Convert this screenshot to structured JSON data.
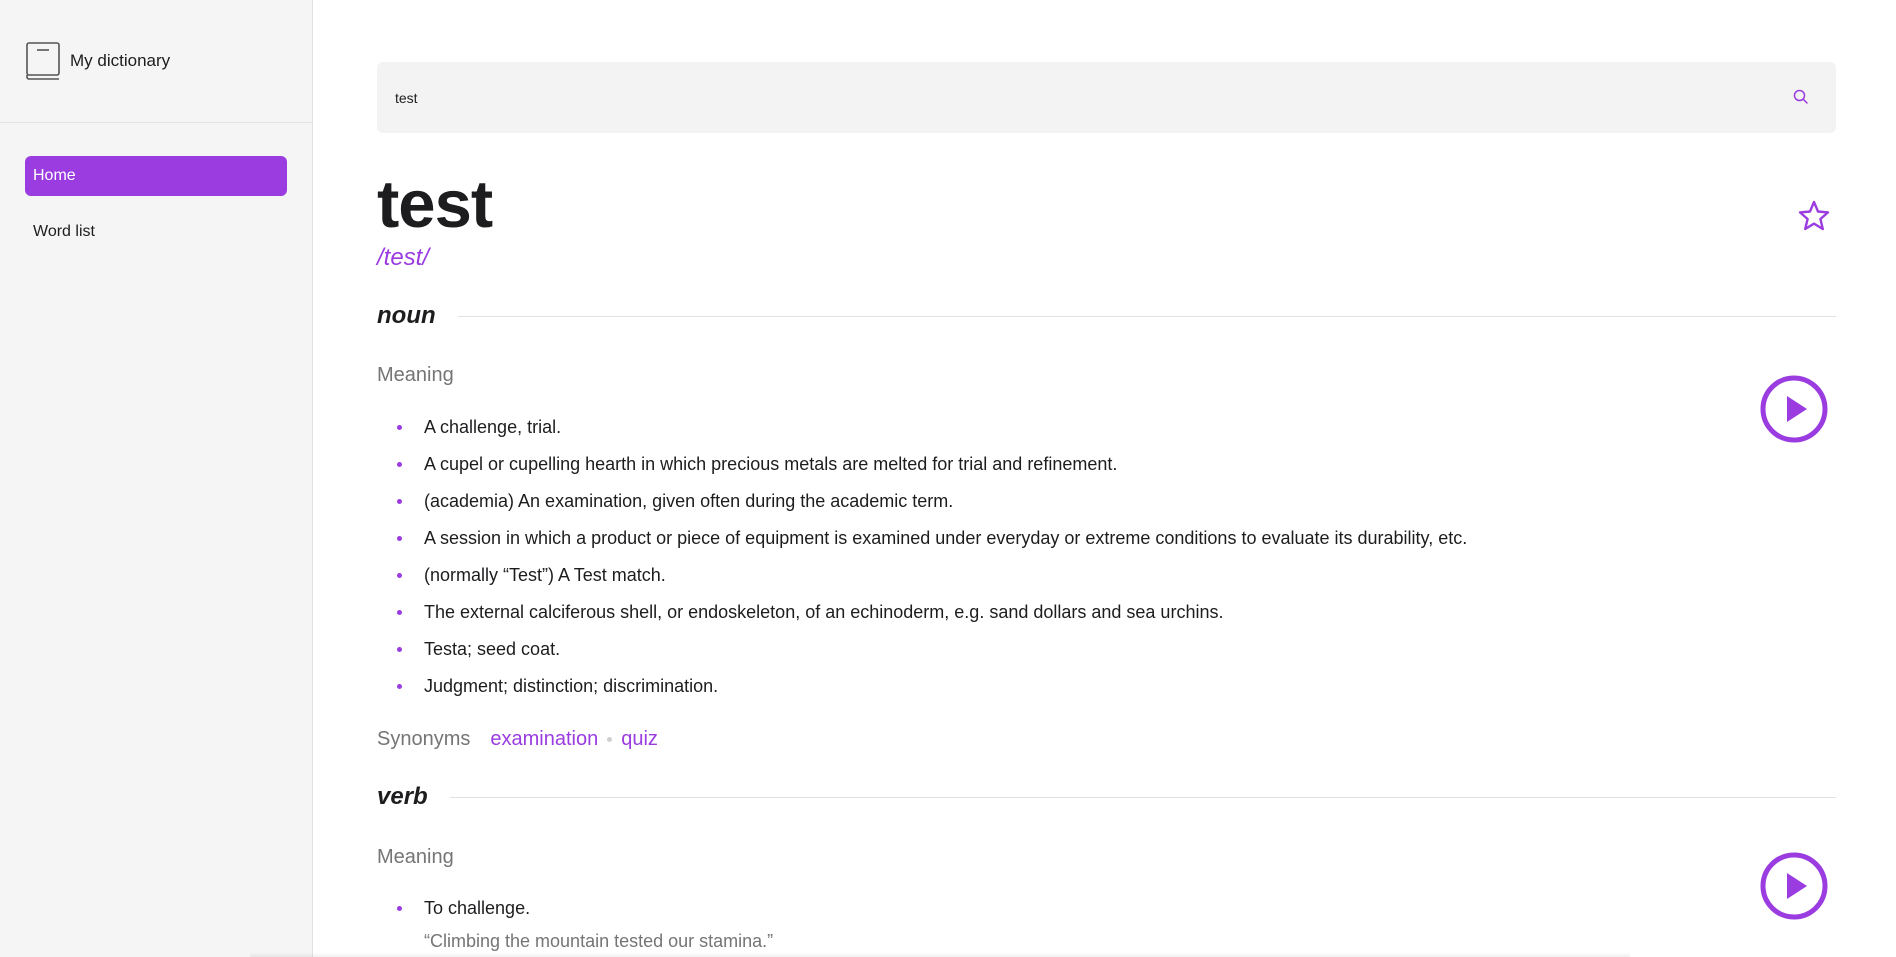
{
  "sidebar": {
    "brand": "My dictionary",
    "items": [
      {
        "label": "Home",
        "active": true
      },
      {
        "label": "Word list",
        "active": false
      }
    ]
  },
  "search": {
    "value": "test",
    "icon": "search-icon"
  },
  "entry": {
    "word": "test",
    "phonetic": "/test/",
    "favorite_icon": "star-outline-icon",
    "meanings": [
      {
        "part_of_speech": "noun",
        "meaning_label": "Meaning",
        "definitions": [
          "A challenge, trial.",
          "A cupel or cupelling hearth in which precious metals are melted for trial and refinement.",
          "(academia) An examination, given often during the academic term.",
          "A session in which a product or piece of equipment is examined under everyday or extreme conditions to evaluate its durability, etc.",
          "(normally “Test”) A Test match.",
          "The external calciferous shell, or endoskeleton, of an echinoderm, e.g. sand dollars and sea urchins.",
          "Testa; seed coat.",
          "Judgment; distinction; discrimination."
        ],
        "synonyms_label": "Synonyms",
        "synonyms": [
          "examination",
          "quiz"
        ]
      },
      {
        "part_of_speech": "verb",
        "meaning_label": "Meaning",
        "definitions": [
          "To challenge."
        ],
        "example": "“Climbing the mountain tested our stamina.”"
      }
    ]
  },
  "colors": {
    "accent": "#9a3ce0",
    "sidebar_bg": "#f5f5f5",
    "search_bg": "#f3f3f3",
    "muted": "#757575"
  }
}
